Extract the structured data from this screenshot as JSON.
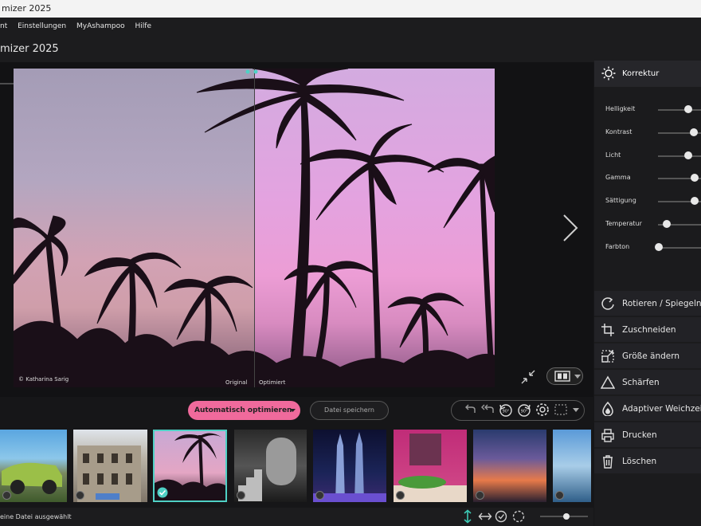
{
  "window": {
    "title": "mizer 2025"
  },
  "menu": [
    "nt",
    "Einstellungen",
    "MyAshampoo",
    "Hilfe"
  ],
  "app": {
    "title": "mizer 2025"
  },
  "preview": {
    "credit": "© Katharina Sarig",
    "label_original": "Original",
    "label_optimized": "Optimiert"
  },
  "toolbar": {
    "auto_optimize_label": "Automatisch optimieren",
    "save_label": "Datei speichern"
  },
  "status": {
    "text": "eine Datei ausgewählt"
  },
  "panel": {
    "korrektur_label": "Korrektur",
    "sliders": [
      {
        "label": "Helligkeit",
        "value": 0.68
      },
      {
        "label": "Kontrast",
        "value": 0.82
      },
      {
        "label": "Licht",
        "value": 0.68
      },
      {
        "label": "Gamma",
        "value": 0.84
      },
      {
        "label": "Sättigung",
        "value": 0.84
      },
      {
        "label": "Temperatur",
        "value": 0.18
      },
      {
        "label": "Farbton",
        "value": 0.0
      }
    ],
    "tools": [
      {
        "label": "Rotieren / Spiegeln",
        "icon": "rotate-icon"
      },
      {
        "label": "Zuschneiden",
        "icon": "crop-icon"
      },
      {
        "label": "Größe ändern",
        "icon": "resize-icon"
      },
      {
        "label": "Schärfen",
        "icon": "sharpen-icon"
      },
      {
        "label": "Adaptiver Weichzeichner",
        "icon": "drop-icon"
      },
      {
        "label": "Drucken",
        "icon": "printer-icon"
      },
      {
        "label": "Löschen",
        "icon": "trash-icon"
      }
    ]
  },
  "colors": {
    "accent": "#f06a9c",
    "selection": "#4fd1c5",
    "status_teal": "#3cc8b4"
  }
}
